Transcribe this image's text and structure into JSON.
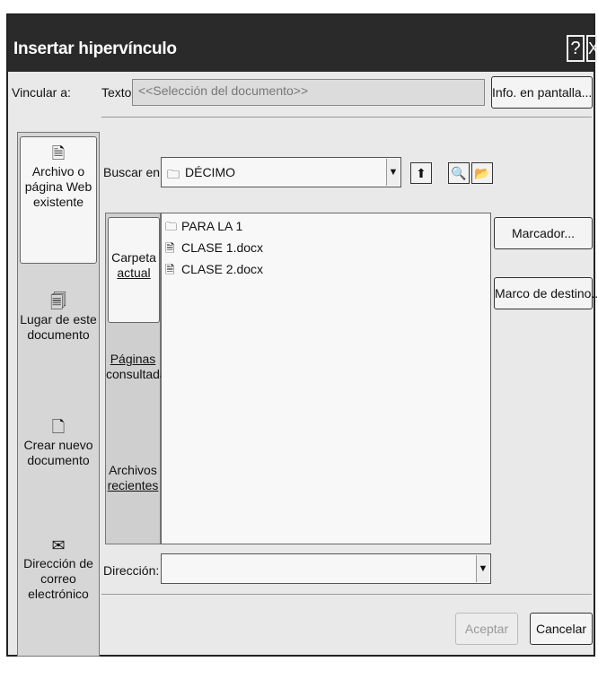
{
  "dialog": {
    "title": "Insertar hipervínculo",
    "help_label": "?",
    "close_label": "X"
  },
  "vincular_label": "Vincular a:",
  "texto": {
    "label": "Texto:",
    "value": "<<Selección del documento>>"
  },
  "info_button": "Info. en pantalla...",
  "sidebar": {
    "items": [
      {
        "line1": "Archivo o",
        "line2": "página Web",
        "line3": "existente",
        "icon": "document-icon"
      },
      {
        "line1": "Lugar de este",
        "line2": "documento",
        "icon": "document-place-icon"
      },
      {
        "line1": "Crear nuevo",
        "line2": "documento",
        "icon": "new-document-icon"
      },
      {
        "line1": "Dirección de",
        "line2": "correo",
        "line3": "electrónico",
        "icon": "email-icon"
      }
    ]
  },
  "buscar": {
    "label": "Buscar en:",
    "value": "DÉCIMO"
  },
  "tabs": [
    {
      "line1": "Carpeta",
      "line2": "actual"
    },
    {
      "line1": "Páginas",
      "line2": "consultadas"
    },
    {
      "line1": "Archivos",
      "line2": "recientes"
    }
  ],
  "files": [
    {
      "name": "PARA LA 1",
      "icon": "folder-icon"
    },
    {
      "name": "CLASE 1.docx",
      "icon": "word-doc-icon"
    },
    {
      "name": "CLASE 2.docx",
      "icon": "word-doc-icon"
    }
  ],
  "marcador_button": "Marcador...",
  "marco_button": "Marco de destino...",
  "direccion": {
    "label": "Dirección:",
    "value": ""
  },
  "aceptar_button": "Aceptar",
  "cancelar_button": "Cancelar"
}
